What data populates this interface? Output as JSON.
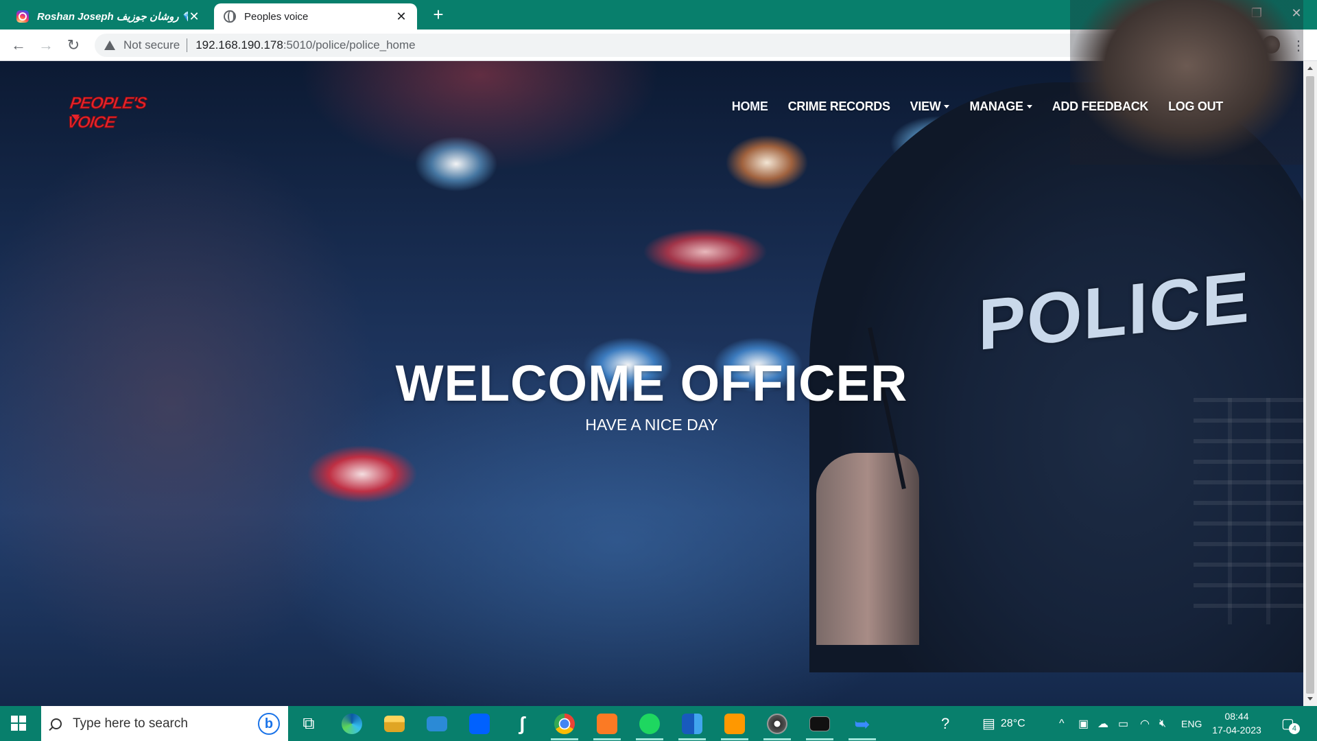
{
  "browser": {
    "tabs": [
      {
        "title": "Roshan Joseph روشان جوزيف 💎",
        "active": false,
        "icon": "instagram-icon"
      },
      {
        "title": "Peoples voice",
        "active": true,
        "icon": "globe-icon"
      }
    ],
    "security_label": "Not secure",
    "url_host": "192.168.190.178",
    "url_path": ":5010/police/police_home",
    "chrome_color": "#087f6c"
  },
  "site": {
    "logo_text": "PEOPLE'S VOICE",
    "nav": [
      {
        "label": "HOME",
        "current": true,
        "dropdown": false
      },
      {
        "label": "CRIME RECORDS",
        "current": false,
        "dropdown": false
      },
      {
        "label": "VIEW",
        "current": false,
        "dropdown": true
      },
      {
        "label": "MANAGE",
        "current": false,
        "dropdown": true
      },
      {
        "label": "ADD FEEDBACK",
        "current": false,
        "dropdown": false
      },
      {
        "label": "LOG OUT",
        "current": false,
        "dropdown": false
      }
    ],
    "hero_title": "WELCOME OFFICER",
    "hero_subtitle": "HAVE A NICE DAY",
    "background_text": "POLICE",
    "brand_color": "#e8232b"
  },
  "taskbar": {
    "search_placeholder": "Type here to search",
    "apps": [
      "task-view-icon",
      "edge-icon",
      "file-explorer-icon",
      "mail-icon",
      "dropbox-icon",
      "app-icon",
      "chrome-icon",
      "xampp-icon",
      "spotify-icon",
      "word-icon",
      "sublime-icon",
      "media-icon",
      "terminal-icon",
      "app-arrow-icon"
    ],
    "weather": "28°C",
    "language": "ENG",
    "time": "08:44",
    "date": "17-04-2023",
    "notifications": "4"
  }
}
